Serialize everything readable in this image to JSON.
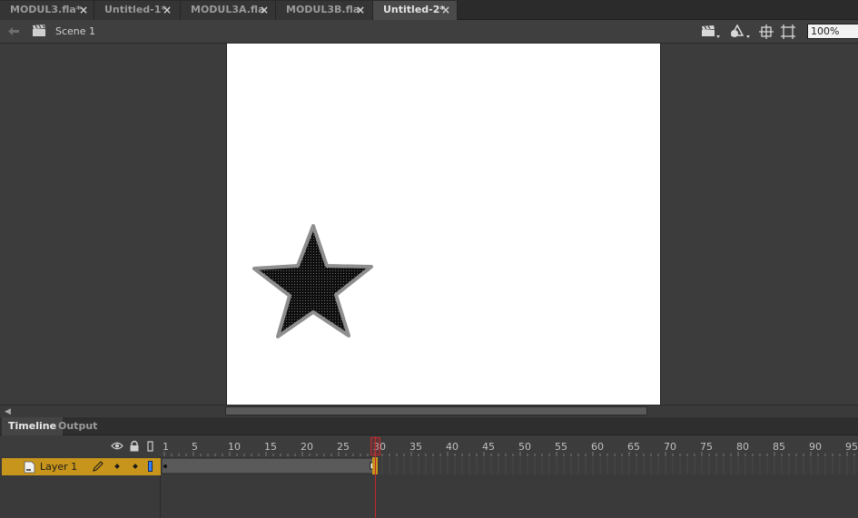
{
  "tabs": [
    {
      "label": "MODUL3.fla*",
      "active": false
    },
    {
      "label": "Untitled-1*",
      "active": false
    },
    {
      "label": "MODUL3A.fla",
      "active": false
    },
    {
      "label": "MODUL3B.fla",
      "active": false
    },
    {
      "label": "Untitled-2*",
      "active": true
    }
  ],
  "tab_close_glyph": "×",
  "editbar": {
    "back_icon": "back-arrow-icon",
    "scene_icon": "clapperboard-icon",
    "scene_label": "Scene 1",
    "right_icons": [
      "edit-scene-icon",
      "edit-symbols-icon",
      "center-stage-icon",
      "clip-content-icon"
    ],
    "zoom": "100%"
  },
  "stage": {
    "background": "#ffffff",
    "shape": "star",
    "shape_fill": "#111111",
    "shape_stroke": "#9a9a9a"
  },
  "panel_tabs": {
    "timeline": "Timeline",
    "output": "Output"
  },
  "timeline": {
    "header_icons": [
      "eye-icon",
      "lock-icon",
      "outline-icon"
    ],
    "ruler_numbers": [
      "1",
      "5",
      "10",
      "15",
      "20",
      "25",
      "30",
      "35",
      "40",
      "45",
      "50",
      "55",
      "60",
      "65",
      "70",
      "75",
      "80",
      "85",
      "90",
      "95"
    ],
    "current_frame": 30,
    "layers": [
      {
        "name": "Layer 1",
        "selected": true,
        "color": "#2d7fff",
        "span_end_frame": 30
      }
    ]
  },
  "colors": {
    "accent": "#c8951c",
    "playhead": "#c0272d"
  }
}
